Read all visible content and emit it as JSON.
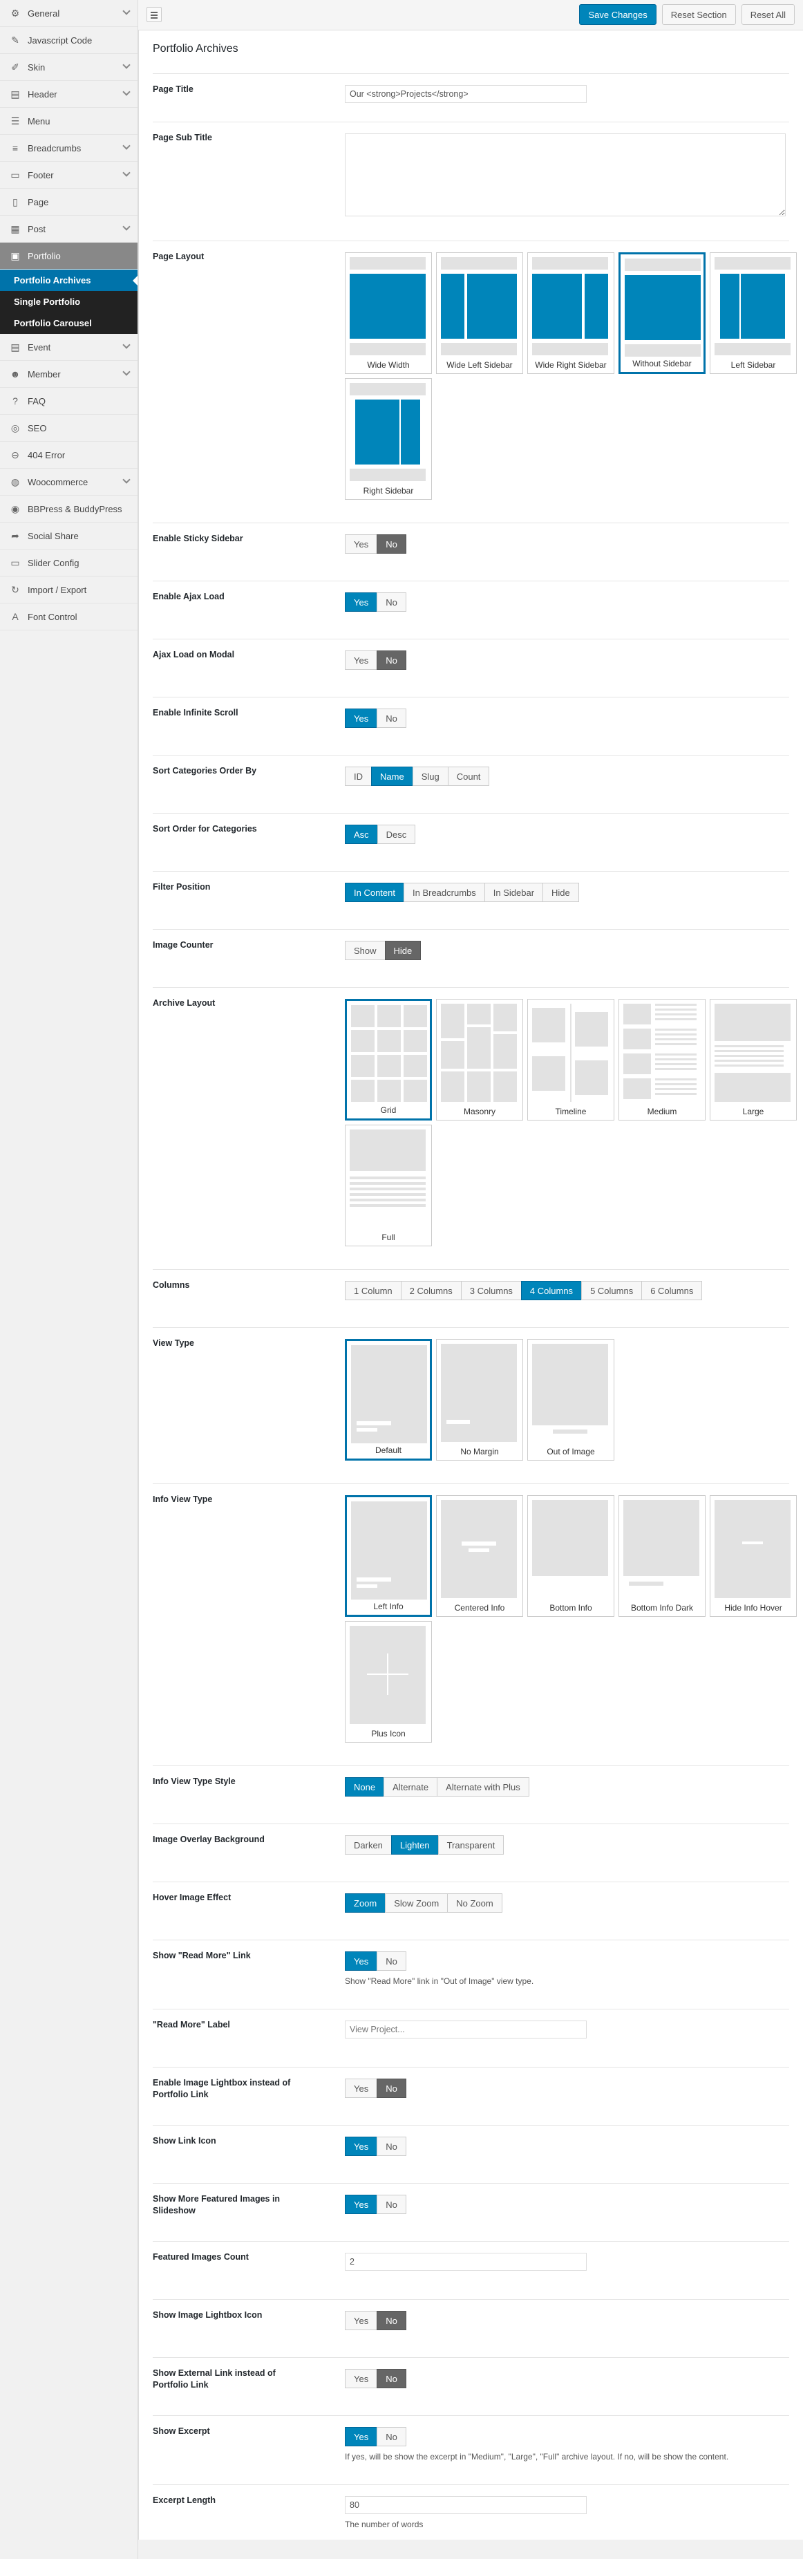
{
  "sidebar": {
    "items": [
      {
        "label": "General",
        "icon": "gear-icon",
        "glyph": "⚙",
        "chevron": true
      },
      {
        "label": "Javascript Code",
        "icon": "code-icon",
        "glyph": "✎",
        "chevron": false
      },
      {
        "label": "Skin",
        "icon": "brush-icon",
        "glyph": "✐",
        "chevron": true
      },
      {
        "label": "Header",
        "icon": "header-icon",
        "glyph": "▤",
        "chevron": true
      },
      {
        "label": "Menu",
        "icon": "menu-icon",
        "glyph": "☰",
        "chevron": false
      },
      {
        "label": "Breadcrumbs",
        "icon": "breadcrumbs-icon",
        "glyph": "≡",
        "chevron": true
      },
      {
        "label": "Footer",
        "icon": "footer-icon",
        "glyph": "▭",
        "chevron": true
      },
      {
        "label": "Page",
        "icon": "page-icon",
        "glyph": "▯",
        "chevron": false
      },
      {
        "label": "Post",
        "icon": "post-icon",
        "glyph": "▦",
        "chevron": true
      },
      {
        "label": "Portfolio",
        "icon": "portfolio-icon",
        "glyph": "▣",
        "chevron": false,
        "active": true
      }
    ],
    "sub": [
      {
        "label": "Portfolio Archives",
        "current": true
      },
      {
        "label": "Single Portfolio"
      },
      {
        "label": "Portfolio Carousel"
      }
    ],
    "items2": [
      {
        "label": "Event",
        "icon": "calendar-icon",
        "glyph": "▤",
        "chevron": true
      },
      {
        "label": "Member",
        "icon": "user-icon",
        "glyph": "☻",
        "chevron": true
      },
      {
        "label": "FAQ",
        "icon": "question-icon",
        "glyph": "?",
        "chevron": false
      },
      {
        "label": "SEO",
        "icon": "globe-icon",
        "glyph": "◎",
        "chevron": false
      },
      {
        "label": "404 Error",
        "icon": "error-icon",
        "glyph": "⊖",
        "chevron": false
      },
      {
        "label": "Woocommerce",
        "icon": "cart-icon",
        "glyph": "◍",
        "chevron": true
      },
      {
        "label": "BBPress & BuddyPress",
        "icon": "forum-icon",
        "glyph": "◉",
        "chevron": false
      },
      {
        "label": "Social Share",
        "icon": "share-icon",
        "glyph": "➦",
        "chevron": false
      },
      {
        "label": "Slider Config",
        "icon": "slider-icon",
        "glyph": "▭",
        "chevron": false
      },
      {
        "label": "Import / Export",
        "icon": "refresh-icon",
        "glyph": "↻",
        "chevron": false
      },
      {
        "label": "Font Control",
        "icon": "font-icon",
        "glyph": "A",
        "chevron": false
      }
    ]
  },
  "toolbar": {
    "save": "Save Changes",
    "reset_section": "Reset Section",
    "reset_all": "Reset All"
  },
  "panel_title": "Portfolio Archives",
  "fields": {
    "page_title": {
      "label": "Page Title",
      "value": "Our <strong>Projects</strong>"
    },
    "page_sub_title": {
      "label": "Page Sub Title",
      "value": ""
    },
    "page_layout": {
      "label": "Page Layout",
      "options": [
        "Wide Width",
        "Wide Left Sidebar",
        "Wide Right Sidebar",
        "Without Sidebar",
        "Left Sidebar",
        "Right Sidebar"
      ],
      "selected": "Without Sidebar"
    },
    "sticky_sidebar": {
      "label": "Enable Sticky Sidebar",
      "options": [
        "Yes",
        "No"
      ],
      "selected": "No"
    },
    "ajax_load": {
      "label": "Enable Ajax Load",
      "options": [
        "Yes",
        "No"
      ],
      "selected": "Yes"
    },
    "ajax_modal": {
      "label": "Ajax Load on Modal",
      "options": [
        "Yes",
        "No"
      ],
      "selected": "No"
    },
    "infinite_scroll": {
      "label": "Enable Infinite Scroll",
      "options": [
        "Yes",
        "No"
      ],
      "selected": "Yes"
    },
    "sort_by": {
      "label": "Sort Categories Order By",
      "options": [
        "ID",
        "Name",
        "Slug",
        "Count"
      ],
      "selected": "Name"
    },
    "sort_order": {
      "label": "Sort Order for Categories",
      "options": [
        "Asc",
        "Desc"
      ],
      "selected": "Asc"
    },
    "filter_position": {
      "label": "Filter Position",
      "options": [
        "In Content",
        "In Breadcrumbs",
        "In Sidebar",
        "Hide"
      ],
      "selected": "In Content"
    },
    "image_counter": {
      "label": "Image Counter",
      "options": [
        "Show",
        "Hide"
      ],
      "selected": "Hide"
    },
    "archive_layout": {
      "label": "Archive Layout",
      "options": [
        "Grid",
        "Masonry",
        "Timeline",
        "Medium",
        "Large",
        "Full"
      ],
      "selected": "Grid"
    },
    "columns": {
      "label": "Columns",
      "options": [
        "1 Column",
        "2 Columns",
        "3 Columns",
        "4 Columns",
        "5 Columns",
        "6 Columns"
      ],
      "selected": "4 Columns"
    },
    "view_type": {
      "label": "View Type",
      "options": [
        "Default",
        "No Margin",
        "Out of Image"
      ],
      "selected": "Default"
    },
    "info_view_type": {
      "label": "Info View Type",
      "options": [
        "Left Info",
        "Centered Info",
        "Bottom Info",
        "Bottom Info Dark",
        "Hide Info Hover",
        "Plus Icon"
      ],
      "selected": "Left Info"
    },
    "info_view_style": {
      "label": "Info View Type Style",
      "options": [
        "None",
        "Alternate",
        "Alternate with Plus"
      ],
      "selected": "None"
    },
    "overlay_bg": {
      "label": "Image Overlay Background",
      "options": [
        "Darken",
        "Lighten",
        "Transparent"
      ],
      "selected": "Lighten"
    },
    "hover_effect": {
      "label": "Hover Image Effect",
      "options": [
        "Zoom",
        "Slow Zoom",
        "No Zoom"
      ],
      "selected": "Zoom"
    },
    "read_more": {
      "label": "Show \"Read More\" Link",
      "options": [
        "Yes",
        "No"
      ],
      "selected": "Yes",
      "note": "Show \"Read More\" link in \"Out of Image\" view type."
    },
    "read_more_label": {
      "label": "\"Read More\" Label",
      "placeholder": "View Project..."
    },
    "lightbox_instead": {
      "label": "Enable Image Lightbox instead of Portfolio Link",
      "options": [
        "Yes",
        "No"
      ],
      "selected": "No"
    },
    "link_icon": {
      "label": "Show Link Icon",
      "options": [
        "Yes",
        "No"
      ],
      "selected": "Yes"
    },
    "more_featured": {
      "label": "Show More Featured Images in Slideshow",
      "options": [
        "Yes",
        "No"
      ],
      "selected": "Yes"
    },
    "featured_count": {
      "label": "Featured Images Count",
      "value": "2"
    },
    "lightbox_icon": {
      "label": "Show Image Lightbox Icon",
      "options": [
        "Yes",
        "No"
      ],
      "selected": "No"
    },
    "external_link": {
      "label": "Show External Link instead of Portfolio Link",
      "options": [
        "Yes",
        "No"
      ],
      "selected": "No"
    },
    "show_excerpt": {
      "label": "Show Excerpt",
      "options": [
        "Yes",
        "No"
      ],
      "selected": "Yes",
      "note": "If yes, will be show the excerpt in \"Medium\", \"Large\", \"Full\" archive layout. If no, will be show the content."
    },
    "excerpt_length": {
      "label": "Excerpt Length",
      "value": "80",
      "note": "The number of words"
    }
  }
}
